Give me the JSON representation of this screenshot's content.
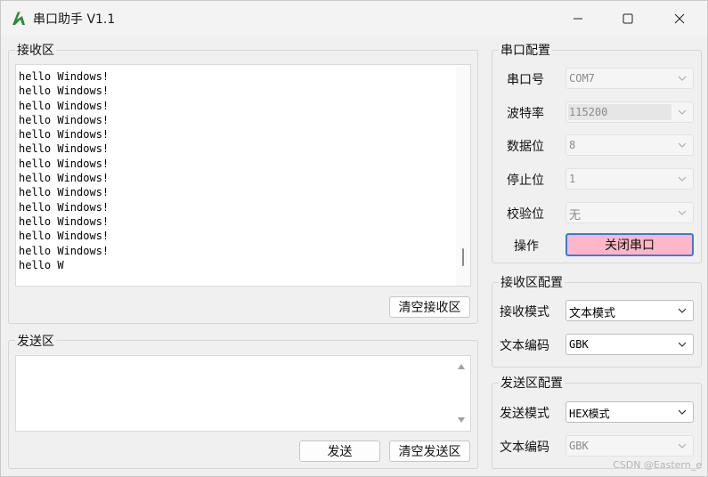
{
  "window": {
    "title": "串口助手 V1.1"
  },
  "receive": {
    "group_title": "接收区",
    "content": "hello Windows!\nhello Windows!\nhello Windows!\nhello Windows!\nhello Windows!\nhello Windows!\nhello Windows!\nhello Windows!\nhello Windows!\nhello Windows!\nhello Windows!\nhello Windows!\nhello Windows!\nhello W",
    "clear_button": "清空接收区"
  },
  "send": {
    "group_title": "发送区",
    "content": "",
    "send_button": "发送",
    "clear_button": "清空发送区"
  },
  "serial_config": {
    "group_title": "串口配置",
    "port_label": "串口号",
    "port_value": "COM7",
    "baud_label": "波特率",
    "baud_value": "115200",
    "databits_label": "数据位",
    "databits_value": "8",
    "stopbits_label": "停止位",
    "stopbits_value": "1",
    "parity_label": "校验位",
    "parity_value": "无",
    "action_label": "操作",
    "action_button": "关闭串口"
  },
  "receive_config": {
    "group_title": "接收区配置",
    "mode_label": "接收模式",
    "mode_value": "文本模式",
    "encoding_label": "文本编码",
    "encoding_value": "GBK"
  },
  "send_config": {
    "group_title": "发送区配置",
    "mode_label": "发送模式",
    "mode_value": "HEX模式",
    "encoding_label": "文本编码",
    "encoding_value": "GBK"
  },
  "watermark": "CSDN @Eastern_e",
  "colors": {
    "close_port_button_bg": "#ffb6c8",
    "close_port_button_border": "#3a7bd5"
  }
}
